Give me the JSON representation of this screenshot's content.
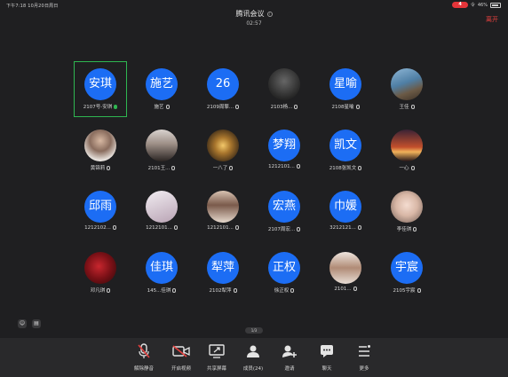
{
  "status_bar": {
    "time": "下午7:18  10月20日周日",
    "recording_badge": "4",
    "wifi_text": "令",
    "battery_text": "46%"
  },
  "meeting": {
    "title": "腾讯会议",
    "duration": "02:57",
    "leave_label": "离开"
  },
  "participants": [
    {
      "avatar_text": "安琪",
      "name": "2107号-安琪",
      "avatar_kind": "text",
      "active": true,
      "mic": "on"
    },
    {
      "avatar_text": "施艺",
      "name": "施艺",
      "avatar_kind": "text",
      "active": false,
      "mic": "muted"
    },
    {
      "avatar_text": "26",
      "name": "2109周擎...",
      "avatar_kind": "text",
      "active": false,
      "mic": "muted"
    },
    {
      "avatar_text": "",
      "name": "2103杨...",
      "avatar_kind": "photo-dark",
      "active": false,
      "mic": "muted"
    },
    {
      "avatar_text": "星喻",
      "name": "2108星喻",
      "avatar_kind": "text",
      "active": false,
      "mic": "muted"
    },
    {
      "avatar_text": "",
      "name": "王佳",
      "avatar_kind": "photo-sea",
      "active": false,
      "mic": "muted"
    },
    {
      "avatar_text": "",
      "name": "黄锦莉",
      "avatar_kind": "photo-person",
      "active": false,
      "mic": "muted"
    },
    {
      "avatar_text": "",
      "name": "2101王...",
      "avatar_kind": "photo-girl",
      "active": false,
      "mic": "muted"
    },
    {
      "avatar_text": "",
      "name": "一八了",
      "avatar_kind": "photo-lights",
      "active": false,
      "mic": "muted"
    },
    {
      "avatar_text": "梦翔",
      "name": "1212101...",
      "avatar_kind": "text",
      "active": false,
      "mic": "muted"
    },
    {
      "avatar_text": "凯文",
      "name": "2108张凯文",
      "avatar_kind": "text",
      "active": false,
      "mic": "muted"
    },
    {
      "avatar_text": "",
      "name": "一心",
      "avatar_kind": "photo-sunset",
      "active": false,
      "mic": "muted"
    },
    {
      "avatar_text": "邱雨",
      "name": "1212102...",
      "avatar_kind": "text",
      "active": false,
      "mic": "muted"
    },
    {
      "avatar_text": "",
      "name": "1212101...",
      "avatar_kind": "photo-anime",
      "active": false,
      "mic": "muted"
    },
    {
      "avatar_text": "",
      "name": "1212101...",
      "avatar_kind": "photo-hair",
      "active": false,
      "mic": "muted"
    },
    {
      "avatar_text": "宏燕",
      "name": "2107周宏...",
      "avatar_kind": "text",
      "active": false,
      "mic": "muted"
    },
    {
      "avatar_text": "巾媛",
      "name": "3212121...",
      "avatar_kind": "text",
      "active": false,
      "mic": "muted"
    },
    {
      "avatar_text": "",
      "name": "李佳琪",
      "avatar_kind": "photo-face",
      "active": false,
      "mic": "muted"
    },
    {
      "avatar_text": "",
      "name": "邓凡琪",
      "avatar_kind": "photo-roses",
      "active": false,
      "mic": "muted"
    },
    {
      "avatar_text": "佳琪",
      "name": "145...佳琪",
      "avatar_kind": "text",
      "active": false,
      "mic": "muted"
    },
    {
      "avatar_text": "犁萍",
      "name": "2102犁萍",
      "avatar_kind": "text",
      "active": false,
      "mic": "muted"
    },
    {
      "avatar_text": "正权",
      "name": "徐正权",
      "avatar_kind": "text",
      "active": false,
      "mic": "muted"
    },
    {
      "avatar_text": "",
      "name": "2101...",
      "avatar_kind": "photo-woman",
      "active": false,
      "mic": "muted"
    },
    {
      "avatar_text": "宇宸",
      "name": "2105宇宸",
      "avatar_kind": "text",
      "active": false,
      "mic": "muted"
    }
  ],
  "page_indicator": "1/3",
  "toolbar": {
    "items": [
      {
        "label": "解除静音",
        "icon": "mic-off-icon"
      },
      {
        "label": "开启视频",
        "icon": "video-off-icon"
      },
      {
        "label": "共享屏幕",
        "icon": "screen-share-icon"
      },
      {
        "label": "成员(24)",
        "icon": "members-icon"
      },
      {
        "label": "邀请",
        "icon": "invite-icon"
      },
      {
        "label": "聊天",
        "icon": "chat-icon"
      },
      {
        "label": "更多",
        "icon": "more-icon"
      }
    ]
  },
  "colors": {
    "avatar_blue": "#1c6df4",
    "active_border": "#2fb651",
    "leave_red": "#e5403f",
    "background": "#1f1f21"
  }
}
